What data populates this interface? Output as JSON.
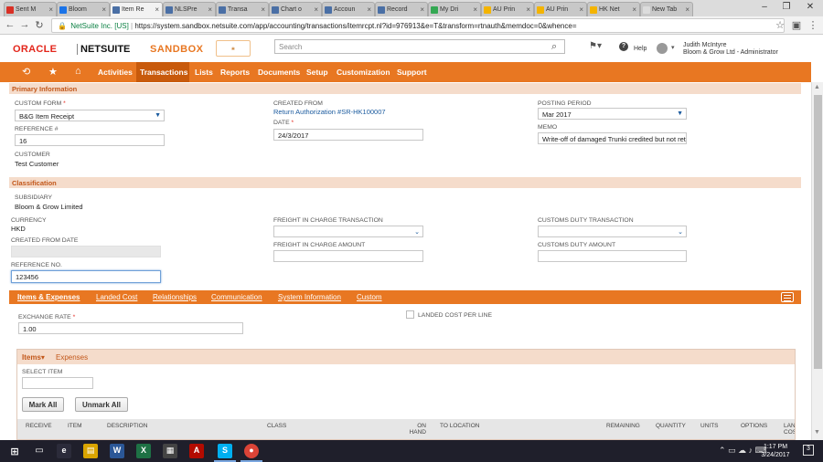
{
  "browser": {
    "tabs": [
      {
        "label": "Sent M",
        "icon_color": "#d93025"
      },
      {
        "label": "Bloom",
        "icon_color": "#1a73e8"
      },
      {
        "label": "Item Re",
        "icon_color": "#4a6fa5",
        "active": true
      },
      {
        "label": "NLSPre",
        "icon_color": "#4a6fa5"
      },
      {
        "label": "Transa",
        "icon_color": "#4a6fa5"
      },
      {
        "label": "Chart o",
        "icon_color": "#4a6fa5"
      },
      {
        "label": "Accoun",
        "icon_color": "#4a6fa5"
      },
      {
        "label": "Record",
        "icon_color": "#4a6fa5"
      },
      {
        "label": "My Dri",
        "icon_color": "#34a853"
      },
      {
        "label": "AU Prin",
        "icon_color": "#f4b400"
      },
      {
        "label": "AU Prin",
        "icon_color": "#f4b400"
      },
      {
        "label": "HK Net",
        "icon_color": "#f4b400"
      },
      {
        "label": "New Tab",
        "icon_color": "#dcdcdc"
      }
    ],
    "secure_label": "NetSuite Inc. [US]",
    "url": "https://system.sandbox.netsuite.com/app/accounting/transactions/itemrcpt.nl?id=976913&e=T&transform=rtnauth&memdoc=0&whence="
  },
  "header": {
    "oracle": "ORACLE",
    "netsuite": "NETSUITE",
    "sandbox": "SANDBOX",
    "search_placeholder": "Search",
    "help": "Help",
    "user_name": "Judith McIntyre",
    "user_role": "Bloom & Grow Ltd - Administrator"
  },
  "nav": {
    "items": [
      "Activities",
      "Transactions",
      "Lists",
      "Reports",
      "Documents",
      "Setup",
      "Customization",
      "Support"
    ]
  },
  "primary": {
    "section_title": "Primary Information",
    "custom_form_label": "CUSTOM FORM",
    "custom_form_value": "B&G Item Receipt",
    "reference_label": "REFERENCE #",
    "reference_value": "16",
    "customer_label": "CUSTOMER",
    "customer_value": "Test Customer",
    "created_from_label": "CREATED FROM",
    "created_from_value": "Return Authorization #SR-HK100007",
    "date_label": "DATE",
    "date_value": "24/3/2017",
    "posting_period_label": "POSTING PERIOD",
    "posting_period_value": "Mar 2017",
    "memo_label": "MEMO",
    "memo_value": "Write-off of damaged Trunki credited but not returned"
  },
  "classification": {
    "section_title": "Classification",
    "subsidiary_label": "SUBSIDIARY",
    "subsidiary_value": "Bloom & Grow Limited",
    "currency_label": "CURRENCY",
    "currency_value": "HKD",
    "created_from_date_label": "CREATED FROM DATE",
    "reference_no_label": "REFERENCE NO.",
    "reference_no_value": "123456",
    "freight_txn_label": "FREIGHT IN CHARGE TRANSACTION",
    "freight_amt_label": "FREIGHT IN CHARGE AMOUNT",
    "customs_txn_label": "CUSTOMS DUTY TRANSACTION",
    "customs_amt_label": "CUSTOMS DUTY AMOUNT"
  },
  "subtabs": [
    "Items & Expenses",
    "Landed Cost",
    "Relationships",
    "Communication",
    "System Information",
    "Custom"
  ],
  "items_expenses": {
    "exchange_rate_label": "EXCHANGE RATE",
    "exchange_rate_value": "1.00",
    "landed_cost_label": "LANDED COST PER LINE",
    "item_tabs": [
      "Items",
      "Expenses"
    ],
    "select_item_label": "SELECT ITEM",
    "mark_all": "Mark All",
    "unmark_all": "Unmark All",
    "columns": [
      "RECEIVE",
      "ITEM",
      "DESCRIPTION",
      "CLASS",
      "ON HAND",
      "TO LOCATION",
      "REMAINING",
      "QUANTITY",
      "UNITS",
      "OPTIONS",
      "LAN COS"
    ]
  },
  "taskbar": {
    "time": "1:17 PM",
    "date": "3/24/2017"
  }
}
